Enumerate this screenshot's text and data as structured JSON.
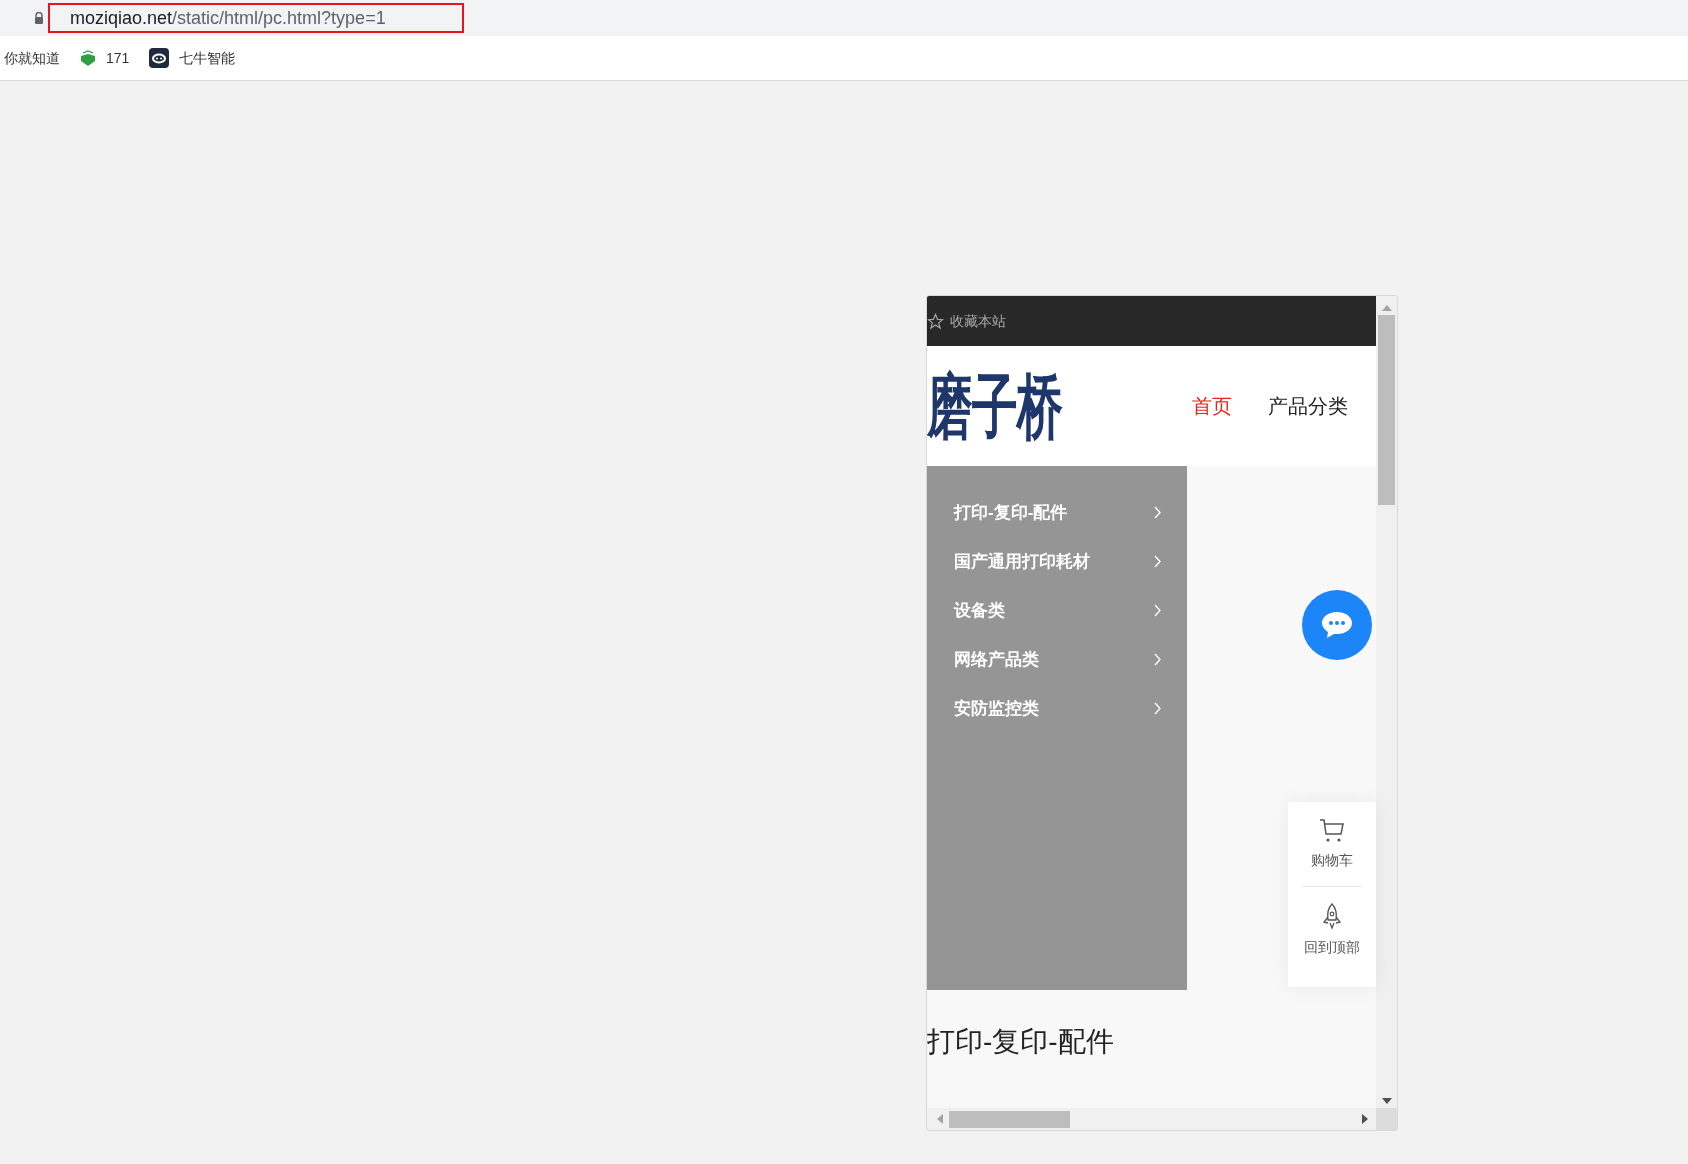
{
  "browser": {
    "url_host": "moziqiao.net",
    "url_path": "/static/html/pc.html?type=1",
    "bookmarks": [
      {
        "kind": "text",
        "label": "你就知道"
      },
      {
        "kind": "shield",
        "label": "171"
      },
      {
        "kind": "robot",
        "label": "七牛智能"
      }
    ]
  },
  "site": {
    "topbar": {
      "favorite": "收藏本站"
    },
    "logo": "磨子桥",
    "nav": [
      {
        "label": "首页",
        "selected": true
      },
      {
        "label": "产品分类",
        "selected": false
      }
    ],
    "categories": [
      {
        "label": "打印-复印-配件"
      },
      {
        "label": "国产通用打印耗材"
      },
      {
        "label": "设备类"
      },
      {
        "label": "网络产品类"
      },
      {
        "label": "安防监控类"
      }
    ],
    "float_panel": [
      {
        "kind": "cart",
        "label": "购物车"
      },
      {
        "kind": "top",
        "label": "回到顶部"
      }
    ],
    "section_title": "打印-复印-配件"
  }
}
